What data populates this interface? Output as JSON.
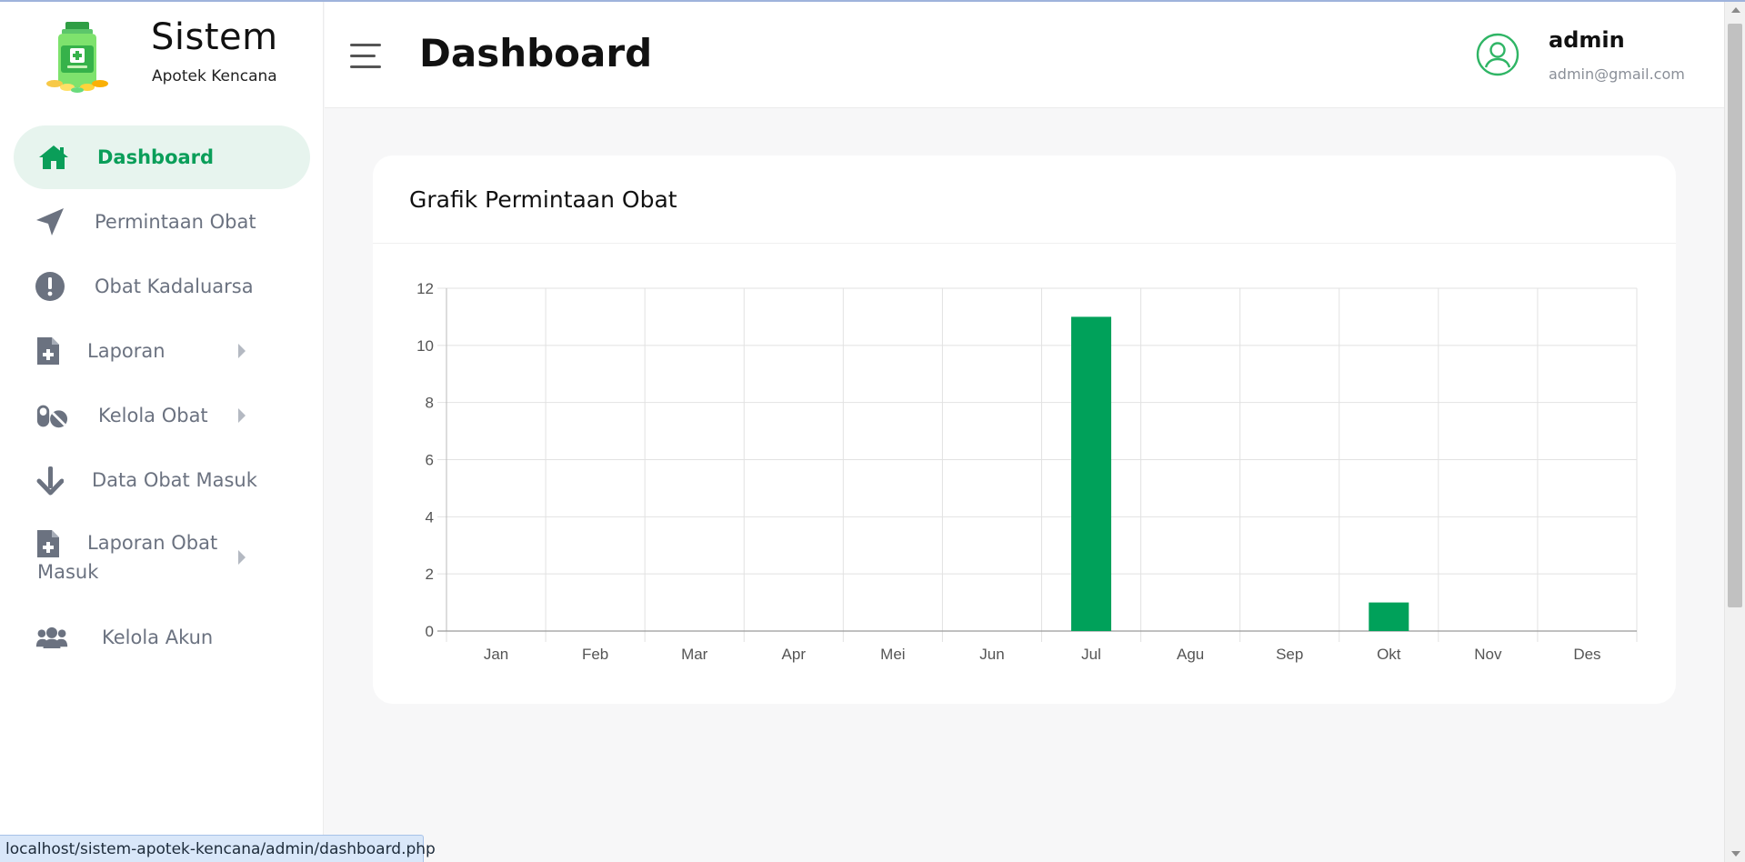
{
  "brand": {
    "title": "Sistem",
    "subtitle": "Apotek Kencana",
    "logo_icon": "medicine-bottle-icon"
  },
  "sidebar": {
    "items": [
      {
        "label": "Dashboard",
        "icon": "home-icon",
        "active": true
      },
      {
        "label": "Permintaan Obat",
        "icon": "paper-plane-icon"
      },
      {
        "label": "Obat Kadaluarsa",
        "icon": "exclamation-circle-icon"
      },
      {
        "label": "Laporan",
        "icon": "file-medical-icon",
        "submenu": true
      },
      {
        "label": "Kelola Obat",
        "icon": "pills-icon",
        "submenu": true
      },
      {
        "label": "Data Obat Masuk",
        "icon": "arrow-down-icon"
      },
      {
        "label_line1": "Laporan Obat",
        "label_line2": "Masuk",
        "icon": "file-medical-icon",
        "submenu": true
      },
      {
        "label": "Kelola Akun",
        "icon": "users-icon"
      }
    ]
  },
  "header": {
    "title": "Dashboard",
    "user_name": "admin",
    "user_email": "admin@gmail.com"
  },
  "card": {
    "title": "Grafik Permintaan Obat"
  },
  "chart_data": {
    "type": "bar",
    "categories": [
      "Jan",
      "Feb",
      "Mar",
      "Apr",
      "Mei",
      "Jun",
      "Jul",
      "Agu",
      "Sep",
      "Okt",
      "Nov",
      "Des"
    ],
    "values": [
      0,
      0,
      0,
      0,
      0,
      0,
      11,
      0,
      0,
      1,
      0,
      0
    ],
    "ylim": [
      0,
      12
    ],
    "yticks": [
      0,
      2,
      4,
      6,
      8,
      10,
      12
    ],
    "grid": true,
    "bar_color": "#00a15a"
  },
  "statusbar": {
    "url": "localhost/sistem-apotek-kencana/admin/dashboard.php"
  },
  "colors": {
    "accent": "#0a9e59",
    "active_bg": "#e7f4ee",
    "muted": "#6b7280"
  }
}
